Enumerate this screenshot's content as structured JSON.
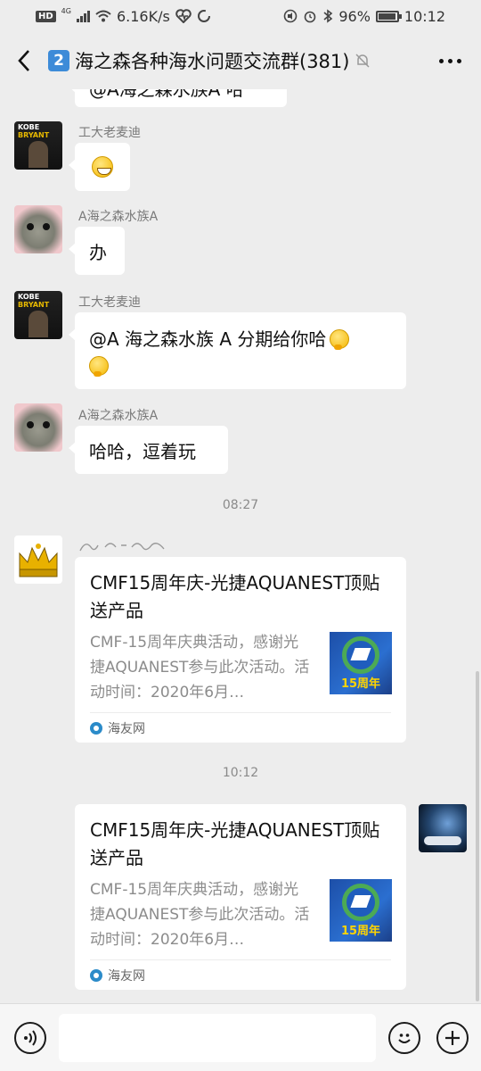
{
  "status_bar": {
    "network_badge": "HD",
    "signal_label": "4G",
    "speed": "6.16K/s",
    "battery": "96%",
    "battery_level": 0.96,
    "time": "10:12"
  },
  "header": {
    "title_badge": "2",
    "title": "海之森各种海水问题交流群(381)"
  },
  "messages": [
    {
      "sender": "",
      "text": "@A海之森水族A 哈"
    },
    {
      "sender": "工大老麦迪",
      "text": ""
    },
    {
      "sender": "A海之森水族A",
      "text": "办"
    },
    {
      "sender": "工大老麦迪",
      "text": "@A 海之森水族 A  分期给你哈"
    },
    {
      "sender": "A海之森水族A",
      "text": "哈哈，逗着玩"
    }
  ],
  "timestamps": [
    "08:27",
    "10:12"
  ],
  "cards": [
    {
      "title": "CMF15周年庆-光捷AQUANEST顶贴送产品",
      "desc": "CMF-15周年庆典活动，感谢光捷AQUANEST参与此次活动。活动时间：2020年6月…",
      "thumb_text": "15周年",
      "source": "海友网"
    },
    {
      "title": "CMF15周年庆-光捷AQUANEST顶贴送产品",
      "desc": "CMF-15周年庆典活动，感谢光捷AQUANEST参与此次活动。活动时间：2020年6月…",
      "thumb_text": "15周年",
      "source": "海友网"
    }
  ],
  "colors": {
    "background": "#ededed",
    "bubble": "#ffffff",
    "badge_blue": "#3d8bd8"
  }
}
